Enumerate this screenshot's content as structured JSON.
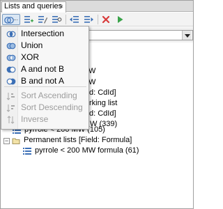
{
  "panel": {
    "tab_label": "Lists and queries",
    "tab_close_glyph": "×"
  },
  "toolbar": {
    "buttons": [
      "set-operations-icon",
      "add-list-icon",
      "edit-list-icon",
      "list-query-icon",
      "import-list-icon",
      "export-list-icon",
      "delete-icon",
      "run-icon"
    ],
    "more_glyph": "..."
  },
  "menu": {
    "items": [
      {
        "label": "Intersection",
        "icon": "intersection-icon",
        "enabled": true
      },
      {
        "label": "Union",
        "icon": "union-icon",
        "enabled": true
      },
      {
        "label": "XOR",
        "icon": "xor-icon",
        "enabled": true
      },
      {
        "label": "A and not B",
        "icon": "a-not-b-icon",
        "enabled": true
      },
      {
        "label": "B and not A",
        "icon": "b-not-a-icon",
        "enabled": true
      },
      {
        "label": "Sort Ascending",
        "icon": "sort-ascending-icon",
        "enabled": false
      },
      {
        "label": "Sort Descending",
        "icon": "sort-descending-icon",
        "enabled": false
      },
      {
        "label": "Inverse",
        "icon": "inverse-icon",
        "enabled": false
      }
    ]
  },
  "tree": {
    "partial_rows": [
      {
        "text": "W"
      },
      {
        "text": "W"
      },
      {
        "text": "d: CdId]"
      },
      {
        "text": "rking list"
      },
      {
        "text": "d: CdId]"
      },
      {
        "text": "W (339)"
      }
    ],
    "pyrrole_row": "pyrrole < 200 MW (105)",
    "permanent_group": "Permanent lists [Field: Formula]",
    "permanent_child": "pyrrole < 200 MW formula (61)"
  },
  "colors": {
    "accent": "#3b6fb6",
    "delete": "#d83a3a",
    "run": "#3aa34a"
  }
}
